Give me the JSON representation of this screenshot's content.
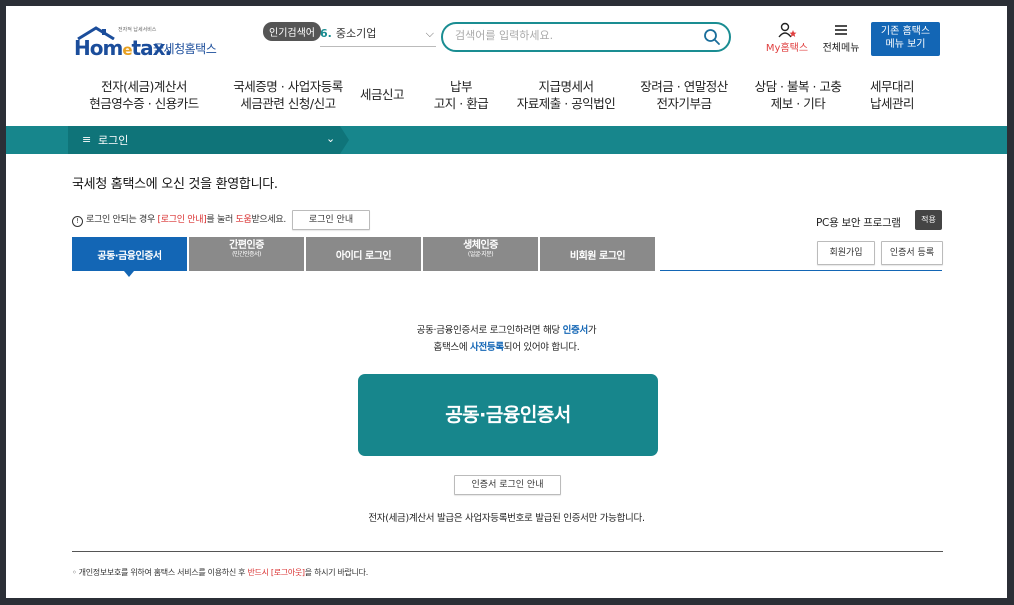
{
  "header": {
    "logo_small": "전자적 납세서비스",
    "logo_word_a": "Hom",
    "logo_word_e": "e",
    "logo_word_b": "tax.",
    "logo_name": "국세청홈택스",
    "popular_badge": "인기검색어",
    "popular_num": "6.",
    "popular_term": "중소기업",
    "search_placeholder": "검색어를 입력하세요.",
    "my_hometax": "My홈택스",
    "all_menu": "전체메뉴",
    "old_menu_line1": "기존 홈택스",
    "old_menu_line2": "메뉴 보기"
  },
  "gnb": [
    {
      "line1": "전자(세금)계산서",
      "line2": "현금영수증 · 신용카드"
    },
    {
      "line1": "국세증명 · 사업자등록",
      "line2": "세금관련 신청/신고"
    },
    {
      "line1": "세금신고",
      "line2": ""
    },
    {
      "line1": "납부",
      "line2": "고지 · 환급"
    },
    {
      "line1": "지급명세서",
      "line2": "자료제출 · 공익법인"
    },
    {
      "line1": "장려금 · 연말정산",
      "line2": "전자기부금"
    },
    {
      "line1": "상담 · 불복 · 고충",
      "line2": "제보 · 기타"
    },
    {
      "line1": "세무대리",
      "line2": "납세관리"
    }
  ],
  "breadcrumb": {
    "label": "로그인"
  },
  "content": {
    "welcome": "국세청 홈택스에 오신 것을 환영합니다.",
    "notice_a": "로그인 안되는 경우 ",
    "notice_red1": "[로그인 안내]",
    "notice_b": "를 눌러 ",
    "notice_red2": "도움",
    "notice_c": "받으세요.",
    "login_guide_btn": "로그인 안내",
    "pc_security": "PC용 보안 프로그램",
    "pc_apply": "적용",
    "signup_btn": "회원가입",
    "cert_register_btn": "인증서 등록",
    "tabs": [
      {
        "label": "공동·금융인증서",
        "sub": ""
      },
      {
        "label": "간편인증",
        "sub": "(민간인증서)"
      },
      {
        "label": "아이디 로그인",
        "sub": ""
      },
      {
        "label": "생체인증",
        "sub": "(얼굴·지문)"
      },
      {
        "label": "비회원 로그인",
        "sub": ""
      }
    ],
    "desc1_a": "공동·금융인증서로 로그인하려면 해당 ",
    "desc1_b": "인증서",
    "desc1_c": "가",
    "desc2_a": "홈택스에 ",
    "desc2_b": "사전등록",
    "desc2_c": "되어 있어야 합니다.",
    "cert_login_btn": "공동·금융인증서",
    "cert_guide_btn": "인증서 로그인 안내",
    "tax_note": "전자(세금)계산서 발급은 사업자등록번호로 발급된 인증서만 가능합니다.",
    "footer_a": "◦ 개인정보보호를 위하여 홈택스 서비스를 이용하신 후 ",
    "footer_red": "반드시 [로그아웃]",
    "footer_b": "을 하시기 바랍니다."
  },
  "colors": {
    "teal": "#17868c",
    "blue": "#1366b5",
    "red": "#d93030"
  }
}
